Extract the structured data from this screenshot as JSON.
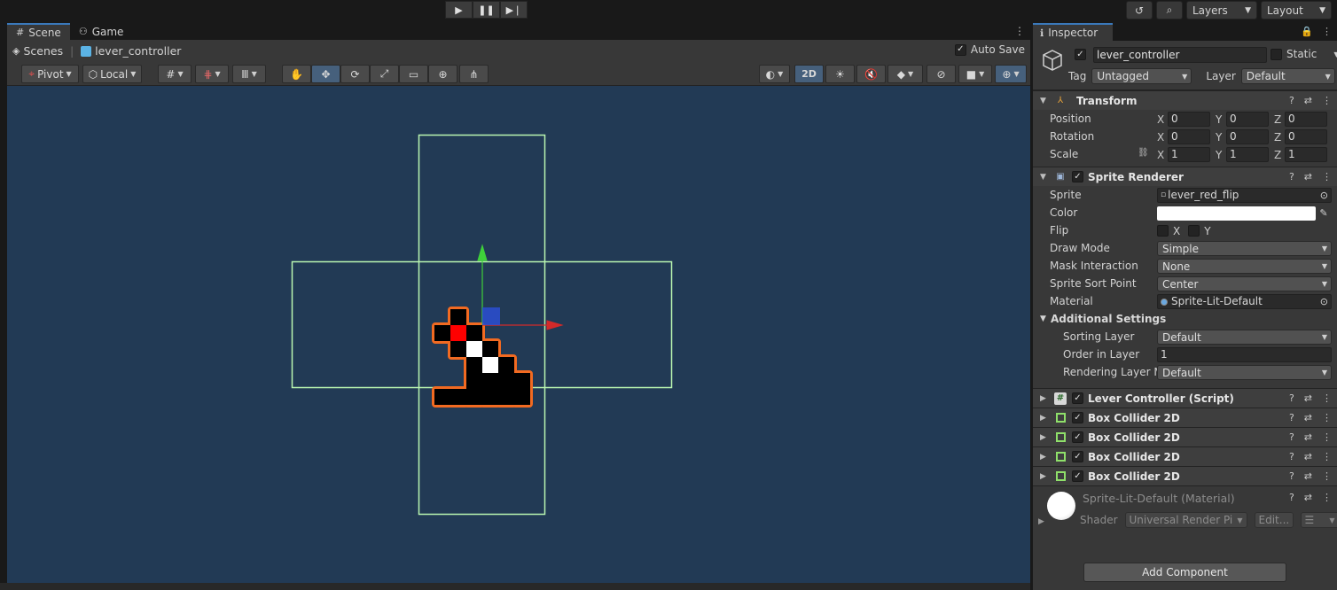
{
  "topbar": {
    "play_icon": "play-icon",
    "pause_icon": "pause-icon",
    "step_icon": "step-icon",
    "history_icon": "history-icon",
    "search_icon": "search-icon",
    "layers_label": "Layers",
    "layout_label": "Layout"
  },
  "scene_panel": {
    "tabs": [
      {
        "label": "Scene",
        "icon": "grid-icon",
        "active": true
      },
      {
        "label": "Game",
        "icon": "gamepad-icon",
        "active": false
      }
    ],
    "breadcrumb": {
      "root": "Scenes",
      "current": "lever_controller"
    },
    "auto_save": {
      "label": "Auto Save",
      "checked": true
    },
    "toolbar": {
      "pivot_label": "Pivot",
      "local_label": "Local",
      "mode_2d_label": "2D"
    }
  },
  "inspector": {
    "tab_label": "Inspector",
    "game_object": {
      "name": "lever_controller",
      "active": true,
      "static_label": "Static",
      "tag_label": "Tag",
      "tag_value": "Untagged",
      "layer_label": "Layer",
      "layer_value": "Default"
    },
    "transform": {
      "title": "Transform",
      "position_label": "Position",
      "rotation_label": "Rotation",
      "scale_label": "Scale",
      "position": {
        "x": "0",
        "y": "0",
        "z": "0"
      },
      "rotation": {
        "x": "0",
        "y": "0",
        "z": "0"
      },
      "scale": {
        "x": "1",
        "y": "1",
        "z": "1"
      },
      "axis_x": "X",
      "axis_y": "Y",
      "axis_z": "Z"
    },
    "sprite_renderer": {
      "title": "Sprite Renderer",
      "sprite_label": "Sprite",
      "sprite_value": "lever_red_flip",
      "color_label": "Color",
      "color_value": "#ffffff",
      "flip_label": "Flip",
      "flip_x": "X",
      "flip_y": "Y",
      "draw_mode_label": "Draw Mode",
      "draw_mode_value": "Simple",
      "mask_label": "Mask Interaction",
      "mask_value": "None",
      "sort_point_label": "Sprite Sort Point",
      "sort_point_value": "Center",
      "material_label": "Material",
      "material_value": "Sprite-Lit-Default",
      "additional_label": "Additional Settings",
      "sorting_layer_label": "Sorting Layer",
      "sorting_layer_value": "Default",
      "order_label": "Order in Layer",
      "order_value": "1",
      "rendering_layer_label": "Rendering Layer M",
      "rendering_layer_value": "Default"
    },
    "components": [
      {
        "title": "Lever Controller (Script)",
        "icon": "script-icon"
      },
      {
        "title": "Box Collider 2D",
        "icon": "box-collider-icon"
      },
      {
        "title": "Box Collider 2D",
        "icon": "box-collider-icon"
      },
      {
        "title": "Box Collider 2D",
        "icon": "box-collider-icon"
      },
      {
        "title": "Box Collider 2D",
        "icon": "box-collider-icon"
      }
    ],
    "material": {
      "title": "Sprite-Lit-Default (Material)",
      "shader_label": "Shader",
      "shader_value": "Universal Render Pipe",
      "edit_label": "Edit..."
    },
    "add_component_label": "Add Component"
  },
  "colors": {
    "scene_bg": "#223a55",
    "collider_outline": "#b9f5b0",
    "selection_outline": "#f26a21",
    "gizmo_x": "#d42a2a",
    "gizmo_y": "#3fd13a",
    "gizmo_z": "#2a4fd4"
  }
}
